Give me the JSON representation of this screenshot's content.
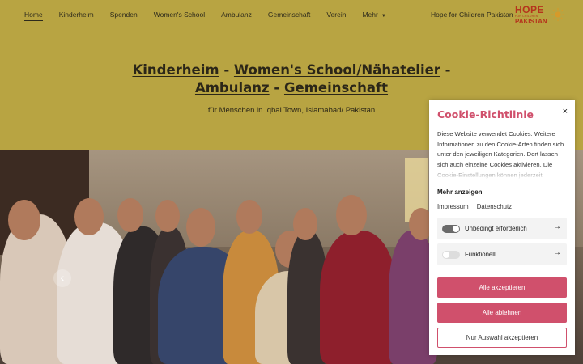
{
  "nav": {
    "items": [
      "Home",
      "Kinderheim",
      "Spenden",
      "Women's School",
      "Ambulanz",
      "Gemeinschaft",
      "Verein",
      "Mehr"
    ],
    "brand_text": "Hope for Children Pakistan",
    "logo": {
      "line1": "HOPE",
      "line2": "FOR CHILDREN",
      "line3": "PAKISTAN"
    }
  },
  "hero": {
    "title_parts": [
      "Kinderheim",
      " - ",
      "Women's School/Nähatelier",
      " - ",
      "Ambulanz",
      " - ",
      "Gemeinschaft"
    ],
    "subtitle": "für Menschen in Iqbal Town, Islamabad/ Pakistan"
  },
  "slider": {
    "prev_icon": "chevron-left-icon",
    "prev_glyph": "‹"
  },
  "cookie": {
    "title": "Cookie-Richtlinie",
    "close_glyph": "×",
    "text": "Diese Website verwendet Cookies. Weitere Informationen zu den Cookie-Arten finden sich unter den jeweiligen Kategorien. Dort lassen sich auch einzelne Cookies aktivieren. Die Cookie-Einstellungen können jederzeit",
    "more": "Mehr anzeigen",
    "links": [
      "Impressum",
      "Datenschutz"
    ],
    "categories": [
      {
        "label": "Unbedingt erforderlich",
        "enabled": true
      },
      {
        "label": "Funktionell",
        "enabled": false
      }
    ],
    "arrow_glyph": "→",
    "accept_all": "Alle akzeptieren",
    "reject_all": "Alle ablehnen",
    "accept_selection": "Nur Auswahl akzeptieren"
  },
  "colors": {
    "background": "#b8a442",
    "accent": "#d0506c",
    "logo": "#b5331c",
    "toggle_on": "#6a6a6a",
    "toggle_off": "#dddddd"
  }
}
